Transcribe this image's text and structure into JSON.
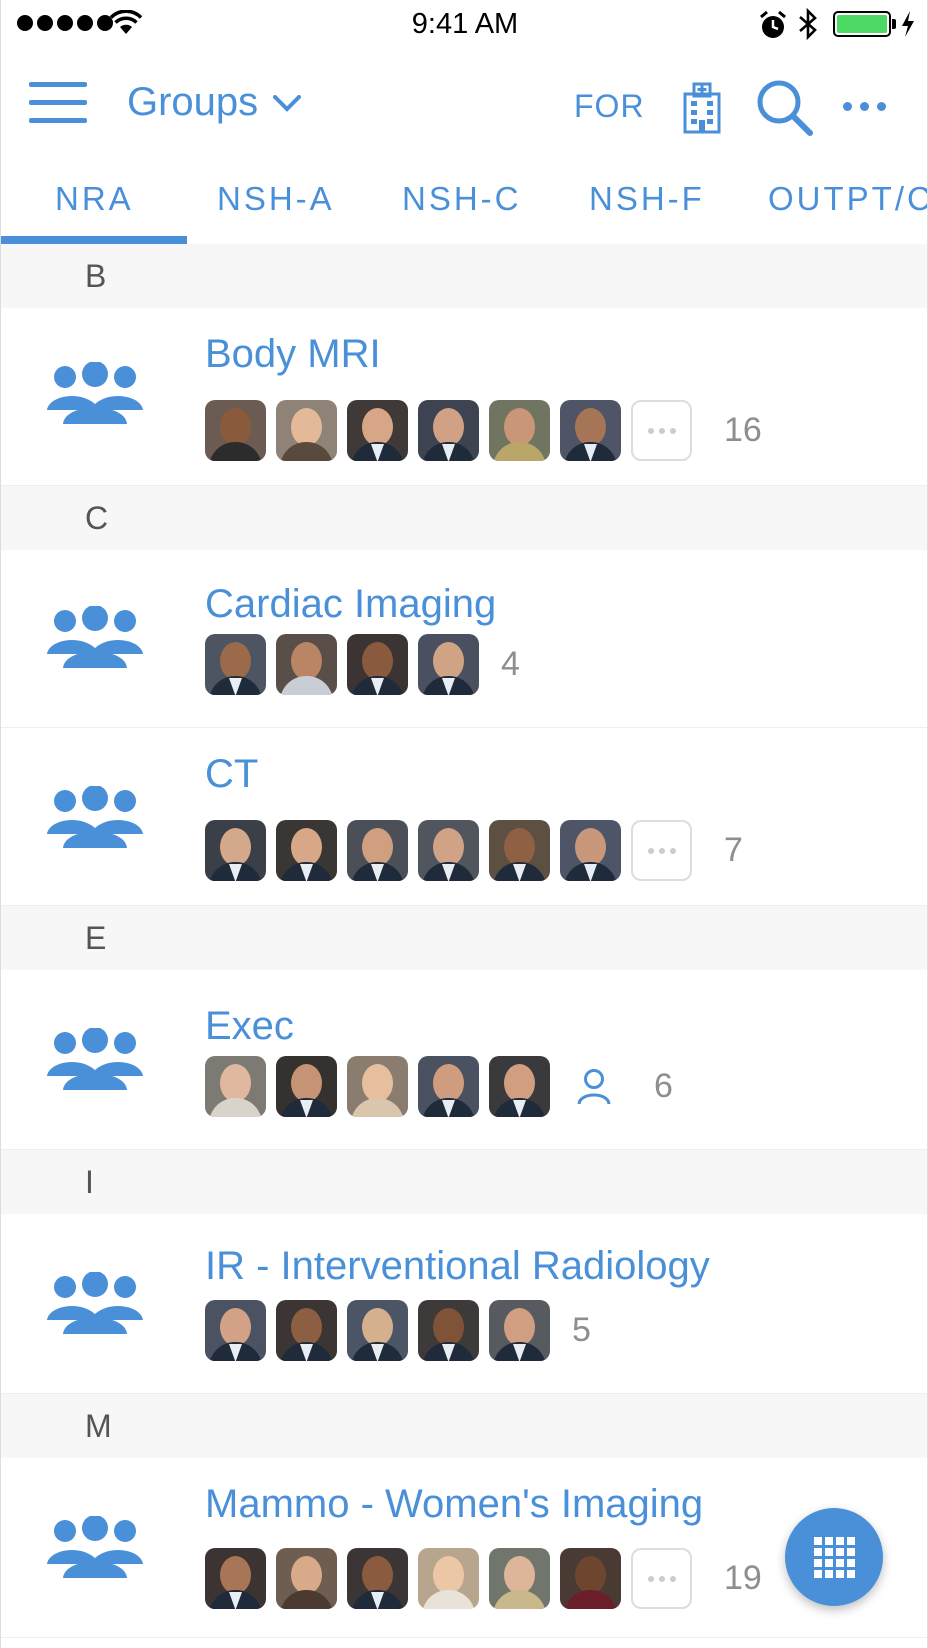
{
  "status_bar": {
    "time": "9:41 AM"
  },
  "nav": {
    "title": "Groups",
    "for_label": "FOR"
  },
  "tabs": [
    {
      "label": "NRA",
      "active": true
    },
    {
      "label": "NSH-A",
      "active": false
    },
    {
      "label": "NSH-C",
      "active": false
    },
    {
      "label": "NSH-F",
      "active": false
    },
    {
      "label": "OUTPT/C",
      "active": false
    }
  ],
  "sections": {
    "b": "B",
    "c": "C",
    "e": "E",
    "i": "I",
    "m": "M"
  },
  "groups": {
    "body_mri": {
      "name": "Body MRI",
      "count": "16"
    },
    "cardiac": {
      "name": "Cardiac Imaging",
      "count": "4"
    },
    "ct": {
      "name": "CT",
      "count": "7"
    },
    "exec": {
      "name": "Exec",
      "count": "6"
    },
    "ir": {
      "name": "IR - Interventional Radiology",
      "count": "5"
    },
    "mammo": {
      "name": "Mammo - Women's Imaging",
      "count": "19"
    }
  },
  "colors": {
    "accent": "#4a90d9",
    "section_bg": "#f7f7f7",
    "count_text": "#8e8e8e",
    "battery": "#4cd964"
  },
  "icons": {
    "menu": "hamburger-menu-icon",
    "dropdown": "chevron-down-icon",
    "hospital": "hospital-building-icon",
    "search": "search-icon",
    "more": "more-horizontal-icon",
    "group": "group-people-icon",
    "person": "person-outline-icon",
    "fab": "dial-pad-grid-icon"
  }
}
